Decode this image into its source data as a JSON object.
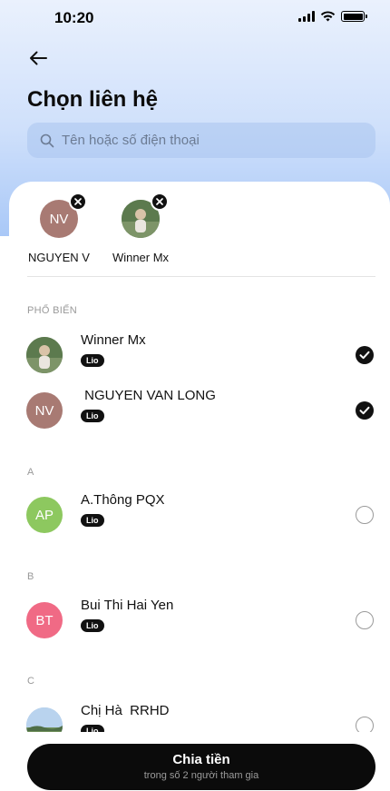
{
  "status_bar": {
    "time": "10:20"
  },
  "header": {
    "title": "Chọn liên hệ"
  },
  "search": {
    "placeholder": "Tên hoặc số điện thoại"
  },
  "selected": [
    {
      "name": "NGUYEN V",
      "initials": "NV",
      "avatar_color": "#a87a73"
    },
    {
      "name": "Winner Mx",
      "initials": "",
      "avatar_color": "#5c7a4e"
    }
  ],
  "sections": {
    "popular": "PHỔ BIẾN",
    "a": "A",
    "b": "B",
    "c": "C"
  },
  "contacts": [
    {
      "name": "Winner Mx",
      "initials": "",
      "tag": "Lio",
      "selected": true,
      "avatar_color": "#5c7a4e"
    },
    {
      "name": " NGUYEN VAN LONG",
      "initials": "NV",
      "tag": "Lio",
      "selected": true,
      "avatar_color": "#a87a73"
    },
    {
      "name": "A.Thông PQX",
      "initials": "AP",
      "tag": "Lio",
      "selected": false,
      "avatar_color": "#8dc85f"
    },
    {
      "name": "Bui Thi Hai Yen",
      "initials": "BT",
      "tag": "Lio",
      "selected": false,
      "avatar_color": "#f06a85"
    },
    {
      "name": "Chị Hà  RRHD",
      "initials": "",
      "tag": "Lio",
      "selected": false,
      "avatar_color": "#8fb3d8"
    }
  ],
  "action_button": {
    "label": "Chia tiền",
    "sublabel": "trong số 2 người tham gia"
  }
}
